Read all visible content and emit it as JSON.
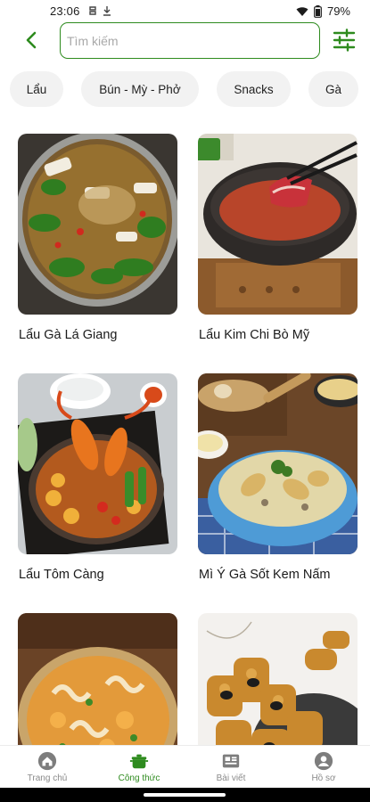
{
  "status_bar": {
    "time": "23:06",
    "battery": "79%"
  },
  "search": {
    "placeholder": "Tìm kiếm",
    "value": ""
  },
  "categories": [
    "Lẩu",
    "Bún - Mỳ - Phở",
    "Snacks",
    "Gà"
  ],
  "recipes": [
    {
      "title": "Lẩu Gà Lá Giang"
    },
    {
      "title": "Lẩu Kim Chi Bò Mỹ"
    },
    {
      "title": "Lẩu Tôm Càng"
    },
    {
      "title": "Mì Ý Gà Sốt Kem Nấm"
    },
    {
      "title": ""
    },
    {
      "title": ""
    }
  ],
  "bottom_nav": [
    {
      "label": "Trang chủ",
      "icon": "home-icon"
    },
    {
      "label": "Công thức",
      "icon": "pot-icon"
    },
    {
      "label": "Bài viết",
      "icon": "article-icon"
    },
    {
      "label": "Hồ sơ",
      "icon": "profile-icon"
    }
  ],
  "colors": {
    "accent": "#2e8b1e",
    "chip_bg": "#f2f2f2",
    "nav_inactive": "#8a8a8a"
  }
}
